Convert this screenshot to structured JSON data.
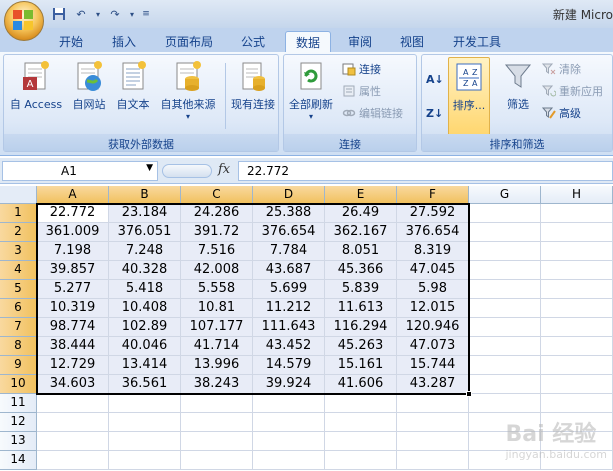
{
  "window": {
    "title": "新建 Micro"
  },
  "tabs": [
    "开始",
    "插入",
    "页面布局",
    "公式",
    "数据",
    "审阅",
    "视图",
    "开发工具"
  ],
  "active_tab": "数据",
  "ribbon": {
    "external_data": {
      "label": "获取外部数据",
      "buttons": [
        "自 Access",
        "自网站",
        "自文本",
        "自其他来源",
        "现有连接"
      ]
    },
    "connections": {
      "label": "连接",
      "refresh_all": "全部刷新",
      "connections": "连接",
      "properties": "属性",
      "edit_links": "编辑链接"
    },
    "sort_filter": {
      "label": "排序和筛选",
      "sort": "排序...",
      "filter": "筛选",
      "clear": "清除",
      "reapply": "重新应用",
      "advanced": "高级"
    }
  },
  "formula_bar": {
    "name_box": "A1",
    "fx": "fx",
    "formula": "22.772"
  },
  "sheet": {
    "columns": [
      "A",
      "B",
      "C",
      "D",
      "E",
      "F",
      "G",
      "H"
    ],
    "rows": [
      "1",
      "2",
      "3",
      "4",
      "5",
      "6",
      "7",
      "8",
      "9",
      "10",
      "11",
      "12",
      "13",
      "14"
    ],
    "data": [
      [
        "22.772",
        "23.184",
        "24.286",
        "25.388",
        "26.49",
        "27.592"
      ],
      [
        "361.009",
        "376.051",
        "391.72",
        "376.654",
        "362.167",
        "376.654"
      ],
      [
        "7.198",
        "7.248",
        "7.516",
        "7.784",
        "8.051",
        "8.319"
      ],
      [
        "39.857",
        "40.328",
        "42.008",
        "43.687",
        "45.366",
        "47.045"
      ],
      [
        "5.277",
        "5.418",
        "5.558",
        "5.699",
        "5.839",
        "5.98"
      ],
      [
        "10.319",
        "10.408",
        "10.81",
        "11.212",
        "11.613",
        "12.015"
      ],
      [
        "98.774",
        "102.89",
        "107.177",
        "111.643",
        "116.294",
        "120.946"
      ],
      [
        "38.444",
        "40.046",
        "41.714",
        "43.452",
        "45.263",
        "47.073"
      ],
      [
        "12.729",
        "13.414",
        "13.996",
        "14.579",
        "15.161",
        "15.744"
      ],
      [
        "34.603",
        "36.561",
        "38.243",
        "39.924",
        "41.606",
        "43.287"
      ]
    ]
  },
  "watermark": {
    "text": "Bai 经验",
    "sub": "jingyan.baidu.com"
  }
}
